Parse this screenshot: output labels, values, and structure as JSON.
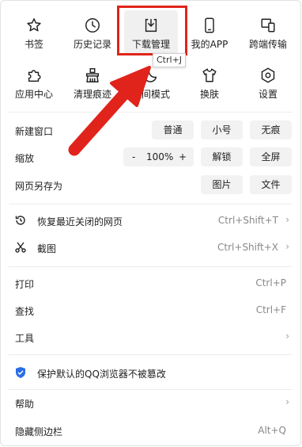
{
  "grid": {
    "row1": [
      {
        "label": "书签",
        "icon": "star-icon"
      },
      {
        "label": "历史记录",
        "icon": "clock-icon"
      },
      {
        "label": "下载管理",
        "icon": "download-icon"
      },
      {
        "label": "我的APP",
        "icon": "phone-icon"
      },
      {
        "label": "跨端传输",
        "icon": "multi-device-icon"
      }
    ],
    "row2": [
      {
        "label": "应用中心",
        "icon": "puzzle-icon"
      },
      {
        "label": "清理痕迹",
        "icon": "broom-icon"
      },
      {
        "label": "夜间模式",
        "icon": "moon-icon"
      },
      {
        "label": "换肤",
        "icon": "shirt-icon"
      },
      {
        "label": "设置",
        "icon": "gear-icon"
      }
    ]
  },
  "tooltip": "Ctrl+J",
  "new_window": {
    "label": "新建窗口",
    "options": [
      "普通",
      "小号",
      "无痕"
    ]
  },
  "zoom": {
    "label": "缩放",
    "minus": "-",
    "value": "100%",
    "plus": "+",
    "unlock": "解锁",
    "fullscreen": "全屏"
  },
  "save_as": {
    "label": "网页另存为",
    "image": "图片",
    "file": "文件"
  },
  "restore": {
    "label": "恢复最近关闭的网页",
    "shortcut": "Ctrl+Shift+T"
  },
  "screenshot": {
    "label": "截图",
    "shortcut": "Ctrl+Shift+X"
  },
  "print": {
    "label": "打印",
    "shortcut": "Ctrl+P"
  },
  "find": {
    "label": "查找",
    "shortcut": "Ctrl+F"
  },
  "tools": {
    "label": "工具"
  },
  "protect": {
    "label": "保护默认的QQ浏览器不被篡改"
  },
  "help": {
    "label": "帮助"
  },
  "hide_sidebar": {
    "label": "隐藏侧边栏",
    "shortcut": "Alt+Q"
  },
  "colors": {
    "highlight": "#e0241b",
    "arrow": "#e0241b",
    "shield": "#2b6de5"
  }
}
